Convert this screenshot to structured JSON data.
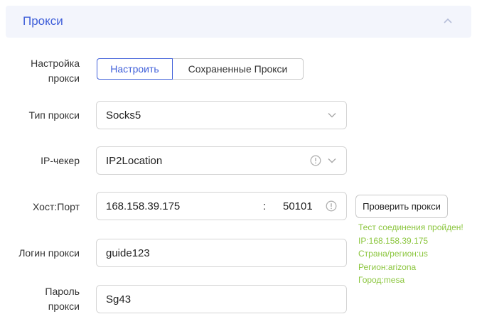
{
  "header": {
    "title": "Прокси",
    "collapse_icon": "chevron-up-icon"
  },
  "proxy_setup": {
    "label": "Настройка\nпрокси",
    "options": [
      "Настроить",
      "Сохраненные Прокси"
    ],
    "selected": "Настроить"
  },
  "proxy_type": {
    "label": "Тип прокси",
    "value": "Socks5",
    "icon": "chevron-down-icon"
  },
  "ip_checker": {
    "label": "IP-чекер",
    "value": "IP2Location",
    "icons": [
      "info-icon",
      "chevron-down-icon"
    ]
  },
  "host_port": {
    "label": "Хост:Порт",
    "host": "168.158.39.175",
    "separator": ":",
    "port": "50101",
    "icon": "info-icon"
  },
  "check_button": {
    "label": "Проверить прокси"
  },
  "test_result": {
    "lines": [
      "Тест соединения пройден!",
      "IP:168.158.39.175",
      "Страна/регион:us",
      "Регион:arizona",
      "Город:mesa"
    ],
    "color": "#8cc63f"
  },
  "login": {
    "label": "Логин прокси",
    "value": "guide123"
  },
  "password": {
    "label": "Пароль\nпрокси",
    "value": "Sg43"
  },
  "colors": {
    "accent": "#3f5fd9",
    "header_bg": "#f3f5fc",
    "success": "#8cc63f"
  }
}
